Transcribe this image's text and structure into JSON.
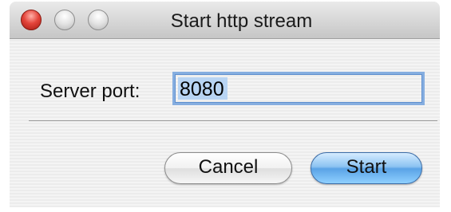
{
  "window": {
    "title": "Start http stream"
  },
  "form": {
    "port_label": "Server port:",
    "port_value": "8080"
  },
  "buttons": {
    "cancel_label": "Cancel",
    "start_label": "Start"
  },
  "icons": {
    "close": "close-window-icon",
    "minimize": "minimize-window-icon",
    "zoom": "zoom-window-icon"
  },
  "colors": {
    "close_button": "#e4453b",
    "default_button": "#5aa3e6",
    "focus_ring": "#86aee0"
  }
}
